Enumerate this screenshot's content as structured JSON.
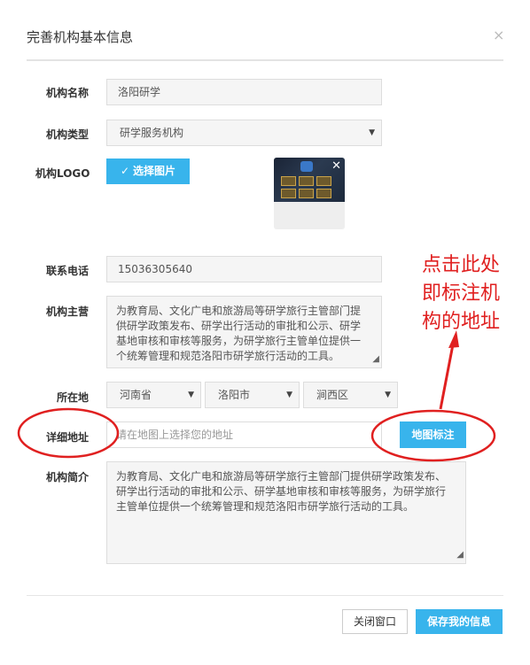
{
  "modal": {
    "title": "完善机构基本信息",
    "close_glyph": "×"
  },
  "form": {
    "name": {
      "label": "机构名称",
      "value": "洛阳研学"
    },
    "type": {
      "label": "机构类型",
      "selected": "研学服务机构"
    },
    "logo": {
      "label": "机构LOGO",
      "button_label": "选择图片",
      "button_icon": "check-icon"
    },
    "phone": {
      "label": "联系电话",
      "value": "15036305640"
    },
    "business": {
      "label": "机构主营",
      "lines": [
        "为教育局、文化广电和旅游局等研学旅行主管部门提",
        "供研学政策发布、研学出行活动的审批和公示、研学",
        "基地审核和审核等服务，为研学旅行主管单位提供一",
        "个统筹管理和规范洛阳市研学旅行活动的工具。"
      ]
    },
    "location": {
      "label": "所在地",
      "province": "河南省",
      "city": "洛阳市",
      "district": "涧西区"
    },
    "address": {
      "label": "详细地址",
      "placeholder": "请在地图上选择您的地址",
      "map_button": "地图标注"
    },
    "intro": {
      "label": "机构简介",
      "lines": [
        "为教育局、文化广电和旅游局等研学旅行主管部门提供研学政策发布、",
        "研学出行活动的审批和公示、研学基地审核和审核等服务，为研学旅行",
        "主管单位提供一个统筹管理和规范洛阳市研学旅行活动的工具。"
      ]
    }
  },
  "footer": {
    "close_label": "关闭窗口",
    "save_label": "保存我的信息"
  },
  "annotation": {
    "lines": [
      "点击此处",
      "即标注机",
      "构的地址"
    ],
    "color": "#e02020"
  },
  "colors": {
    "accent": "#38b4ec",
    "annotation": "#e02020"
  }
}
